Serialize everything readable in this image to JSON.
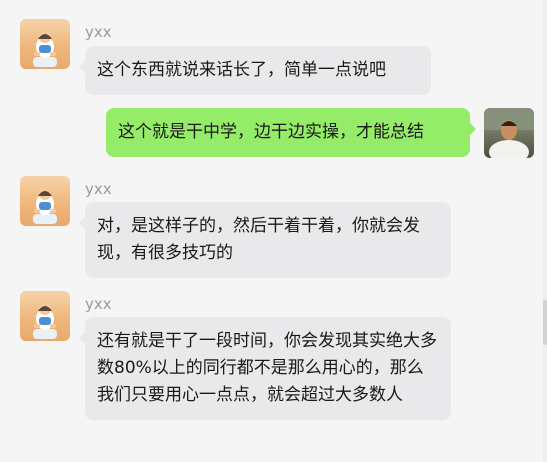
{
  "chat": {
    "messages": [
      {
        "sender": "yxx",
        "text": "这个东西就说来话长了，简单一点说吧",
        "direction": "incoming"
      },
      {
        "text": "这个就是干中学，边干边实操，才能总结",
        "direction": "outgoing"
      },
      {
        "sender": "yxx",
        "text": "对，是这样子的，然后干着干着，你就会发现，有很多技巧的",
        "direction": "incoming"
      },
      {
        "sender": "yxx",
        "text": "还有就是干了一段时间，你会发现其实绝大多数80%以上的同行都不是那么用心的，那么我们只要用心一点点，就会超过大多数人",
        "direction": "incoming"
      }
    ]
  },
  "colors": {
    "background": "#f5f5f5",
    "incoming_bubble": "#e9e9eb",
    "outgoing_bubble": "#95ec69",
    "sender_name": "#9a9a9a"
  },
  "icons": {
    "contact_avatar": "contact-avatar-icon",
    "self_avatar": "self-avatar-icon"
  }
}
